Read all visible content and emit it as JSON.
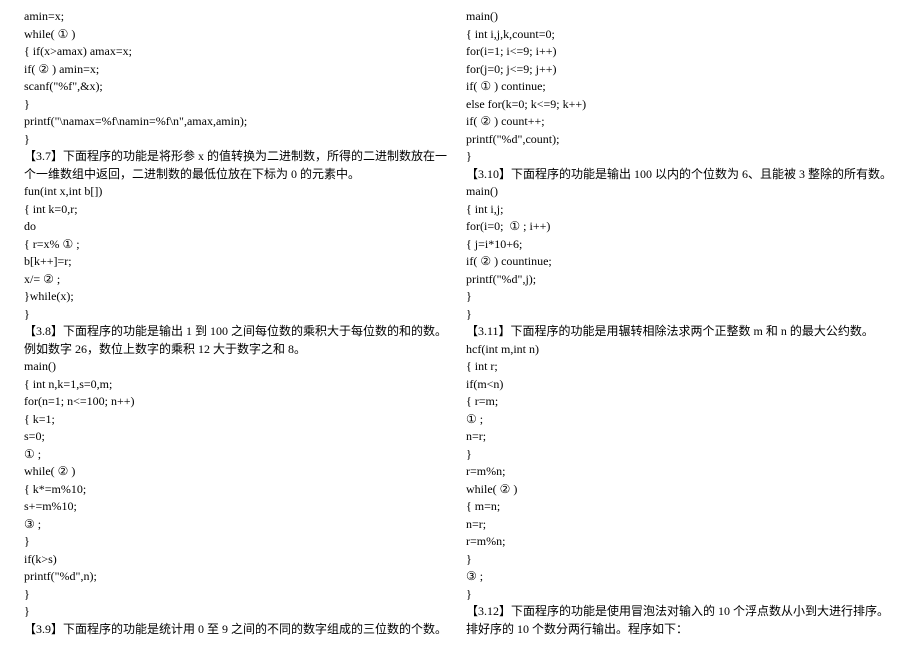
{
  "left": [
    "amin=x;",
    "while( ① )",
    "{ if(x>amax) amax=x;",
    "if( ② ) amin=x;",
    "scanf(\"%f\",&x);",
    "}",
    "printf(\"\\namax=%f\\namin=%f\\n\",amax,amin);",
    "}",
    "【3.7】下面程序的功能是将形参 x 的值转换为二进制数，所得的二进制数放在一个一维数组中返回，二进制数的最低位放在下标为 0 的元素中。",
    "fun(int x,int b[])",
    "{ int k=0,r;",
    "do",
    "{ r=x% ① ;",
    "b[k++]=r;",
    "x/= ② ;",
    "}while(x);",
    "}",
    "【3.8】下面程序的功能是输出 1 到 100 之间每位数的乘积大于每位数的和的数。例如数字 26，数位上数字的乘积 12 大于数字之和 8。",
    "main()",
    "{ int n,k=1,s=0,m;",
    "for(n=1; n<=100; n++)",
    "{ k=1;",
    "s=0;",
    "① ;",
    "while( ② )",
    "{ k*=m%10;",
    "s+=m%10;",
    "③ ;",
    "}",
    "if(k>s)",
    "printf(\"%d\",n);",
    "}",
    "}",
    "【3.9】下面程序的功能是统计用 0 至 9 之间的不同的数字组成的三位数的个数。"
  ],
  "right": [
    "main()",
    "{ int i,j,k,count=0;",
    "for(i=1; i<=9; i++)",
    "for(j=0; j<=9; j++)",
    "if( ① ) continue;",
    "else for(k=0; k<=9; k++)",
    "if( ② ) count++;",
    "printf(\"%d\",count);",
    "}",
    "【3.10】下面程序的功能是输出 100 以内的个位数为 6、且能被 3 整除的所有数。",
    "main()",
    "{ int i,j;",
    "for(i=0;  ① ; i++)",
    "{ j=i*10+6;",
    "if( ② ) countinue;",
    "printf(\"%d\",j);",
    "}",
    "}",
    "【3.11】下面程序的功能是用辗转相除法求两个正整数 m 和 n 的最大公约数。",
    "hcf(int m,int n)",
    "{ int r;",
    "if(m<n)",
    "{ r=m;",
    "① ;",
    "n=r;",
    "}",
    "r=m%n;",
    "while( ② )",
    "{ m=n;",
    "n=r;",
    "r=m%n;",
    "}",
    "③ ;",
    "}",
    "【3.12】下面程序的功能是使用冒泡法对输入的 10 个浮点数从小到大进行排序。排好序的 10 个数分两行输出。程序如下："
  ]
}
